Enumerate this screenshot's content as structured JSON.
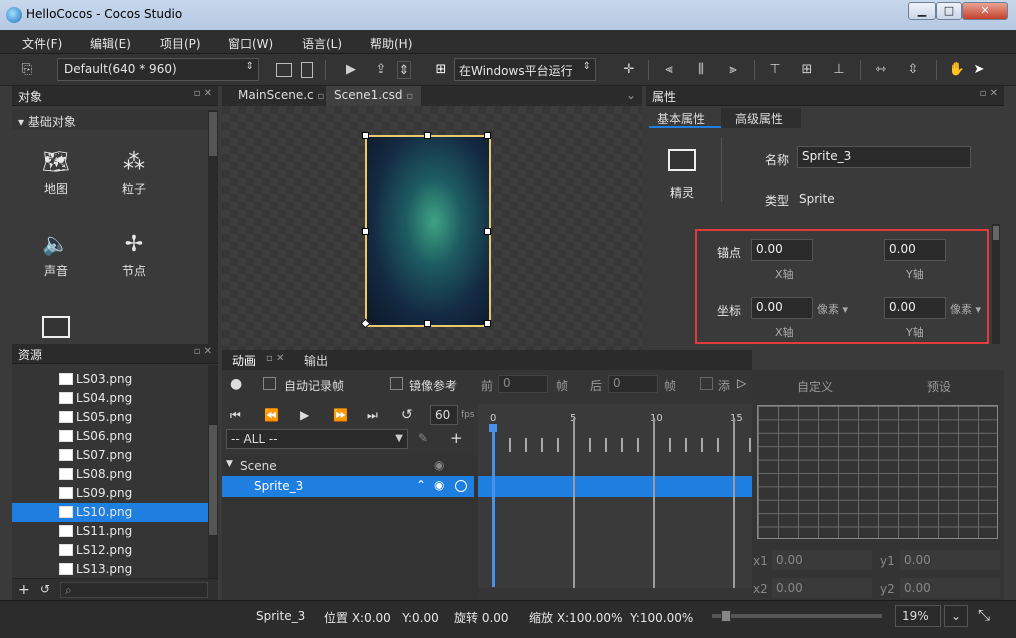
{
  "window": {
    "title": "HelloCocos - Cocos Studio"
  },
  "menu": [
    "文件(F)",
    "编辑(E)",
    "项目(P)",
    "窗口(W)",
    "语言(L)",
    "帮助(H)"
  ],
  "toolbar": {
    "resolution": "Default(640 * 960)",
    "run_target": "在Windows平台运行"
  },
  "objects_panel": {
    "title": "对象",
    "section": "基础对象",
    "items": [
      {
        "label": "地图"
      },
      {
        "label": "粒子"
      },
      {
        "label": "声音"
      },
      {
        "label": "节点"
      }
    ]
  },
  "resources_panel": {
    "title": "资源",
    "files": [
      "LS03.png",
      "LS04.png",
      "LS05.png",
      "LS06.png",
      "LS07.png",
      "LS08.png",
      "LS09.png",
      "LS10.png",
      "LS11.png",
      "LS12.png",
      "LS13.png"
    ],
    "selected": "LS10.png"
  },
  "tabs": [
    "MainScene.c",
    "Scene1.csd"
  ],
  "animation_panel": {
    "tabs": [
      "动画",
      "输出"
    ],
    "auto_record": "自动记录帧",
    "mirror_ref": "镜像参考",
    "prev_label": "前",
    "prev_value": "0",
    "frame_unit": "帧",
    "next_label": "后",
    "next_value": "0",
    "add_label": "添",
    "fps_value": "60",
    "fps_unit": "fps",
    "filter": "-- ALL --",
    "tree": {
      "root": "Scene",
      "child": "Sprite_3"
    },
    "ruler": [
      "0",
      "5",
      "10",
      "15"
    ]
  },
  "curve_panel": {
    "tabs": [
      "自定义",
      "预设"
    ],
    "x1_label": "x1",
    "x1_value": "0.00",
    "y1_label": "y1",
    "y1_value": "0.00",
    "x2_label": "x2",
    "x2_value": "0.00",
    "y2_label": "y2",
    "y2_value": "0.00"
  },
  "properties": {
    "title": "属性",
    "tabs": [
      "基本属性",
      "高级属性"
    ],
    "type_caption": "精灵",
    "name_label": "名称",
    "name_value": "Sprite_3",
    "type_label": "类型",
    "type_value": "Sprite",
    "anchor_label": "锚点",
    "anchor_x": "0.00",
    "anchor_y": "0.00",
    "pos_label": "坐标",
    "pos_x": "0.00",
    "pos_y": "0.00",
    "x_axis": "X轴",
    "y_axis": "Y轴",
    "unit": "像素"
  },
  "status": {
    "name": "Sprite_3",
    "position": "位置 X:0.00   Y:0.00",
    "rotation": "旋转 0.00",
    "scale": "缩放 X:100.00%  Y:100.00%",
    "zoom": "19%",
    "zoom_level": 0.05
  },
  "colors": {
    "accent": "#1e7fe0",
    "highlight": "#e23b3b",
    "selection_border": "#e9c96a"
  }
}
